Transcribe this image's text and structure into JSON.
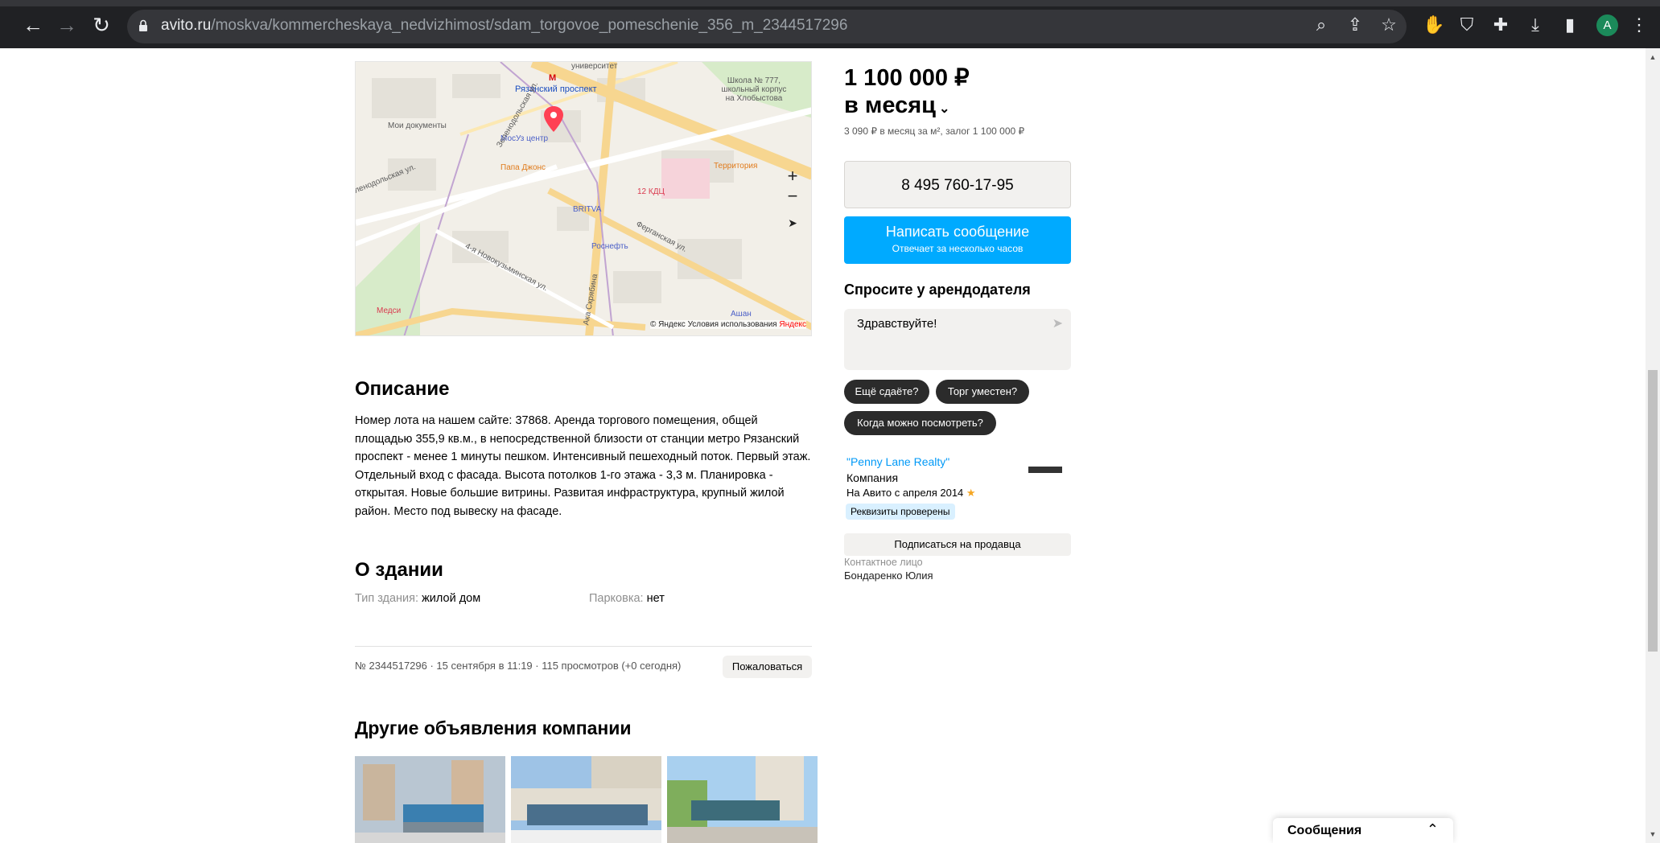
{
  "browser": {
    "url_host": "avito.ru",
    "url_path": "/moskva/kommercheskaya_nedvizhimost/sdam_torgovoe_pomeschenie_356_m_2344517296",
    "avatar_letter": "A"
  },
  "map": {
    "labels": {
      "metro": "Рязанский проспект",
      "school": "Школа № 777,\nшкольный корпус\nна Хлобыстова",
      "docs": "Мои документы",
      "mosuz": "МосУз центр",
      "papa": "Папа Джонс",
      "territory": "Территория",
      "kdc": "12 КДЦ",
      "britva": "BRITVA",
      "rosneft": "Роснефть",
      "fergana": "Ферганская ул.",
      "novokuz": "4-я Новокузьминская ул.",
      "skryabina": "Ака Скрябина",
      "medsi": "Медси",
      "ashan": "Ашан",
      "university": "университет",
      "zelenodolskaya": "Зеленодольская ул.",
      "yenodolskaya": "ленодольская ул."
    },
    "attribution": "© Яндекс Условия использования",
    "yandex_logo": "Яндекс"
  },
  "listing": {
    "price": "1 100 000 ₽",
    "price_period": "в месяц",
    "price_details": "3 090 ₽ в месяц за м², залог 1 100 000 ₽",
    "phone": "8 495 760-17-95",
    "message_button": "Написать сообщение",
    "message_sub": "Отвечает за несколько часов",
    "ask_title": "Спросите у арендодателя",
    "ask_placeholder": "Здравствуйте!",
    "chips": [
      "Ещё сдаёте?",
      "Торг уместен?",
      "Когда можно посмотреть?"
    ]
  },
  "seller": {
    "name": "\"Penny Lane Realty\"",
    "type": "Компания",
    "since": "На Авито с апреля 2014",
    "verified": "Реквизиты проверены",
    "subscribe": "Подписаться на продавца",
    "contact_label": "Контактное лицо",
    "contact_name": "Бондаренко Юлия"
  },
  "description": {
    "title": "Описание",
    "text": "Номер лота на нашем сайте: 37868. Аренда торгового помещения, общей площадью 355,9 кв.м., в непосредственной близости от станции метро Рязанский проспект - менее 1 минуты пешком. Интенсивный пешеходный поток. Первый этаж. Отдельный вход с фасада. Высота потолков 1-го этажа - 3,3 м. Планировка - открытая. Новые большие витрины. Развитая инфраструктура, крупный жилой район. Место под вывеску на фасаде."
  },
  "building": {
    "title": "О здании",
    "type_label": "Тип здания:",
    "type_value": "жилой дом",
    "parking_label": "Парковка:",
    "parking_value": "нет"
  },
  "meta": {
    "info": "№ 2344517296 · 15 сентября в 11:19 · 115 просмотров (+0 сегодня)",
    "complain": "Пожаловаться"
  },
  "other": {
    "title": "Другие объявления компании"
  },
  "messenger": {
    "title": "Сообщения"
  }
}
